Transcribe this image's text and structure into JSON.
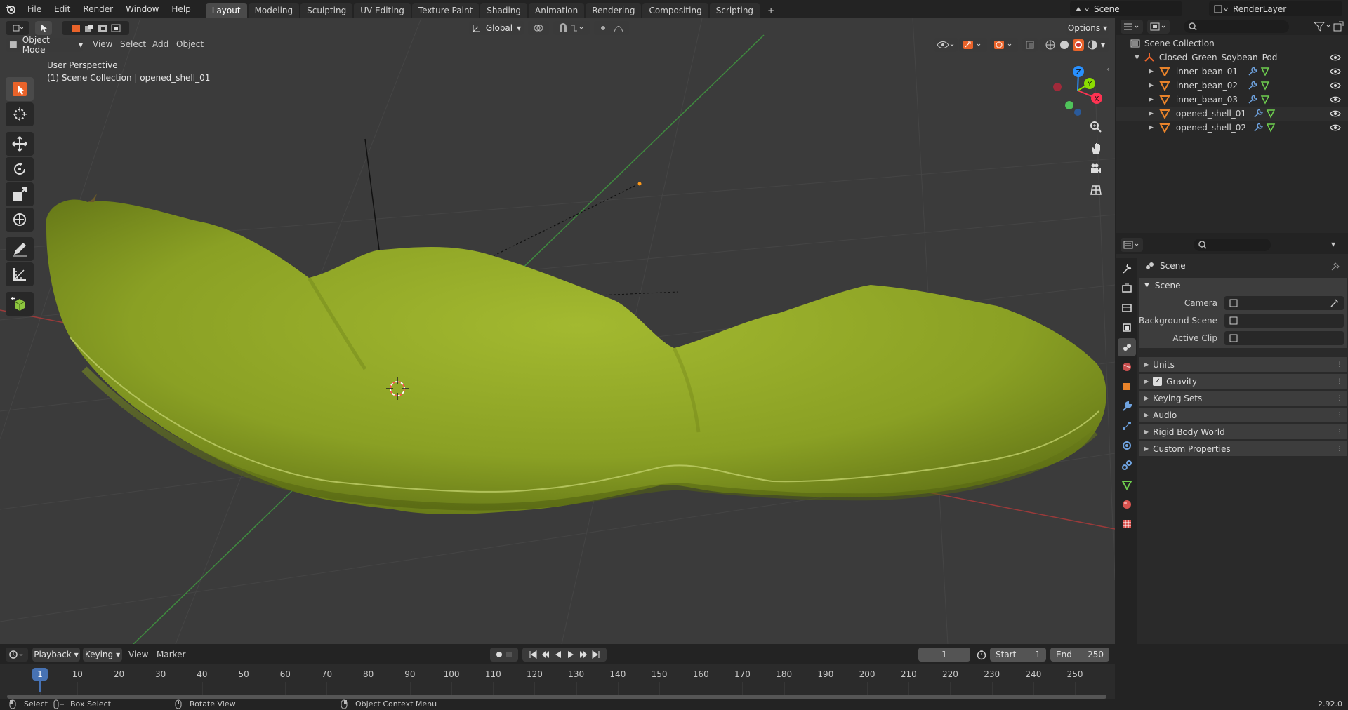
{
  "topbar": {
    "menus": [
      "File",
      "Edit",
      "Render",
      "Window",
      "Help"
    ],
    "workspaces": [
      "Layout",
      "Modeling",
      "Sculpting",
      "UV Editing",
      "Texture Paint",
      "Shading",
      "Animation",
      "Rendering",
      "Compositing",
      "Scripting"
    ],
    "active_workspace": "Layout",
    "add_tab": "+",
    "scene_name": "Scene",
    "view_layer": "RenderLayer"
  },
  "viewport": {
    "mode": "Object Mode",
    "menus": [
      "View",
      "Select",
      "Add",
      "Object"
    ],
    "transform_orientation": "Global",
    "options_label": "Options",
    "perspective_label": "User Perspective",
    "context_label": "(1) Scene Collection | opened_shell_01",
    "gizmo_axes": [
      "Z",
      "Y",
      "X"
    ]
  },
  "outliner": {
    "root": "Scene Collection",
    "collection": "Closed_Green_Soybean_Pod",
    "objects": [
      "inner_bean_01",
      "inner_bean_02",
      "inner_bean_03",
      "opened_shell_01",
      "opened_shell_02"
    ],
    "selected": "opened_shell_01"
  },
  "properties": {
    "header": "Scene",
    "section": "Scene",
    "fields": [
      {
        "label": "Camera"
      },
      {
        "label": "Background Scene"
      },
      {
        "label": "Active Clip"
      }
    ],
    "subpanels": [
      "Units",
      "Gravity",
      "Keying Sets",
      "Audio",
      "Rigid Body World",
      "Custom Properties"
    ],
    "gravity_checked": true
  },
  "timeline": {
    "menus": [
      "Playback",
      "Keying",
      "View",
      "Marker"
    ],
    "current_frame": "1",
    "start_label": "Start",
    "start_value": "1",
    "end_label": "End",
    "end_value": "250",
    "ticks": [
      "1",
      "10",
      "20",
      "30",
      "40",
      "50",
      "60",
      "70",
      "80",
      "90",
      "100",
      "110",
      "120",
      "130",
      "140",
      "150",
      "160",
      "170",
      "180",
      "190",
      "200",
      "210",
      "220",
      "230",
      "240",
      "250"
    ]
  },
  "statusbar": {
    "items": [
      "Select",
      "Box Select",
      "Rotate View",
      "Object Context Menu"
    ],
    "version": "2.92.0"
  },
  "colors": {
    "accent": "#4772b3",
    "active_tool": "#e9632a",
    "x_axis": "#ff3352",
    "y_axis": "#8bdc00",
    "z_axis": "#2890ff",
    "pod": "#8fa826"
  }
}
